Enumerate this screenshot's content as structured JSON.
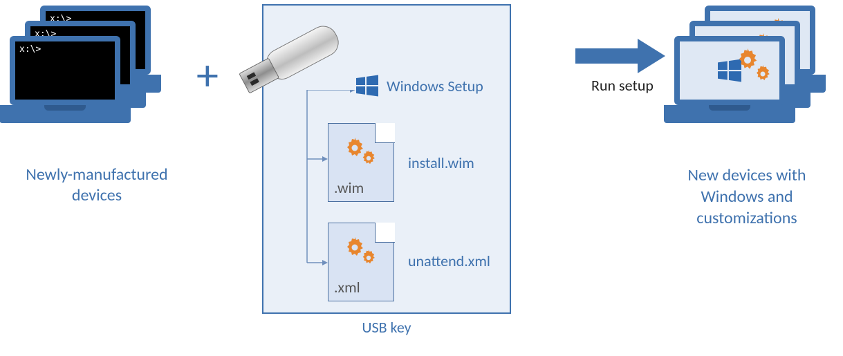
{
  "source": {
    "prompt": "x:\\>",
    "label": "Newly-manufactured devices"
  },
  "plus": "+",
  "usb": {
    "label": "USB key",
    "items": {
      "windows_setup": "Windows Setup",
      "install_wim_label": "install.wim",
      "install_wim_ext": ".wim",
      "unattend_xml_label": "unattend.xml",
      "unattend_xml_ext": ".xml"
    }
  },
  "action": {
    "label": "Run setup"
  },
  "target": {
    "label": "New devices with Windows and customizations"
  },
  "colors": {
    "primary": "#3f72ae",
    "accent_orange": "#e8862e"
  }
}
